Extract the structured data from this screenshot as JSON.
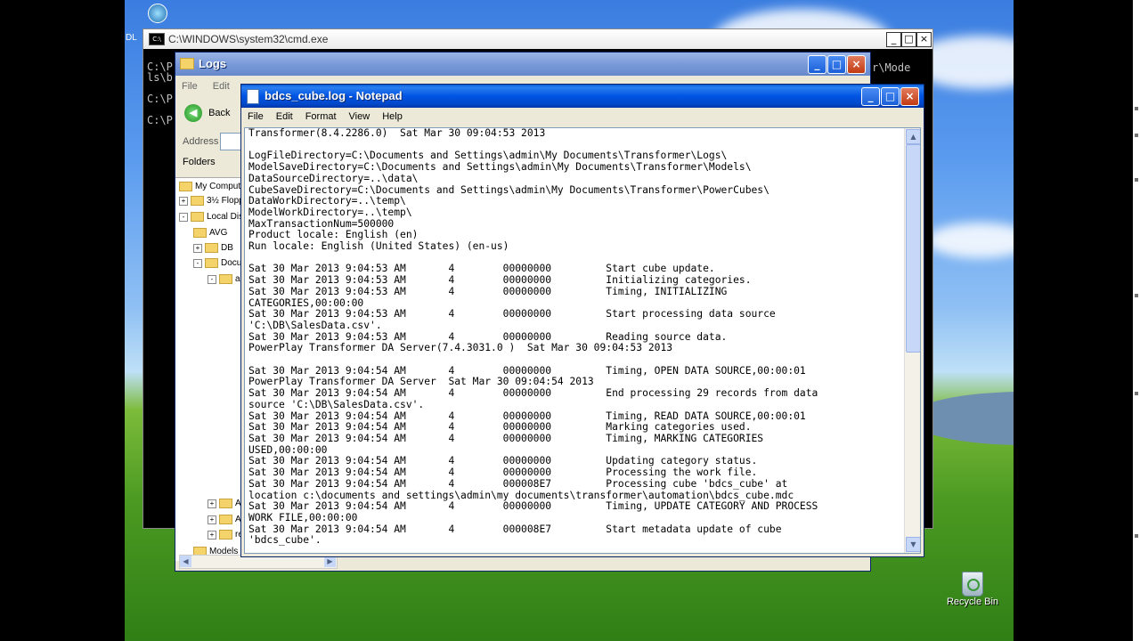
{
  "desktop": {
    "recycle_bin_label": "Recycle Bin",
    "left_edge_label": "DL"
  },
  "cmd_window": {
    "title": "C:\\WINDOWS\\system32\\cmd.exe",
    "visible_lines": [
      "C:\\P",
      "ls\\b",
      "",
      "C:\\P",
      "",
      "C:\\P"
    ],
    "right_fragment": "r\\Mode"
  },
  "explorer_window": {
    "title": "Logs",
    "menu": [
      "File",
      "Edit"
    ],
    "back_label": "Back",
    "address_label": "Address",
    "folders_label": "Folders",
    "tree": [
      {
        "label": "My Computer",
        "indent": 0,
        "expand": ""
      },
      {
        "label": "3½ Floppy",
        "indent": 0,
        "expand": "+"
      },
      {
        "label": "Local Disk",
        "indent": 0,
        "expand": "-"
      },
      {
        "label": "AVG",
        "indent": 1,
        "expand": ""
      },
      {
        "label": "DB",
        "indent": 1,
        "expand": "+"
      },
      {
        "label": "Docum",
        "indent": 1,
        "expand": "-"
      },
      {
        "label": "ad",
        "indent": 2,
        "expand": "-"
      },
      {
        "label": "Ac",
        "indent": 2,
        "expand": "+"
      },
      {
        "label": "All",
        "indent": 2,
        "expand": "+"
      },
      {
        "label": "re",
        "indent": 2,
        "expand": "+"
      },
      {
        "label": "Models",
        "indent": 1,
        "expand": ""
      }
    ]
  },
  "notepad": {
    "title": "bdcs_cube.log - Notepad",
    "menu": [
      "File",
      "Edit",
      "Format",
      "View",
      "Help"
    ],
    "lines": [
      "Transformer(8.4.2286.0)  Sat Mar 30 09:04:53 2013",
      "",
      "LogFileDirectory=C:\\Documents and Settings\\admin\\My Documents\\Transformer\\Logs\\",
      "ModelSaveDirectory=C:\\Documents and Settings\\admin\\My Documents\\Transformer\\Models\\",
      "DataSourceDirectory=..\\data\\",
      "CubeSaveDirectory=C:\\Documents and Settings\\admin\\My Documents\\Transformer\\PowerCubes\\",
      "DataWorkDirectory=..\\temp\\",
      "ModelWorkDirectory=..\\temp\\",
      "MaxTransactionNum=500000",
      "Product locale: English (en)",
      "Run locale: English (United States) (en-us)",
      "",
      "Sat 30 Mar 2013 9:04:53 AM       4        00000000         Start cube update.",
      "Sat 30 Mar 2013 9:04:53 AM       4        00000000         Initializing categories.",
      "Sat 30 Mar 2013 9:04:53 AM       4        00000000         Timing, INITIALIZING",
      "CATEGORIES,00:00:00",
      "Sat 30 Mar 2013 9:04:53 AM       4        00000000         Start processing data source",
      "'C:\\DB\\SalesData.csv'.",
      "Sat 30 Mar 2013 9:04:53 AM       4        00000000         Reading source data.",
      "PowerPlay Transformer DA Server(7.4.3031.0 )  Sat Mar 30 09:04:53 2013",
      "",
      "Sat 30 Mar 2013 9:04:54 AM       4        00000000         Timing, OPEN DATA SOURCE,00:00:01",
      "PowerPlay Transformer DA Server  Sat Mar 30 09:04:54 2013",
      "Sat 30 Mar 2013 9:04:54 AM       4        00000000         End processing 29 records from data",
      "source 'C:\\DB\\SalesData.csv'.",
      "Sat 30 Mar 2013 9:04:54 AM       4        00000000         Timing, READ DATA SOURCE,00:00:01",
      "Sat 30 Mar 2013 9:04:54 AM       4        00000000         Marking categories used.",
      "Sat 30 Mar 2013 9:04:54 AM       4        00000000         Timing, MARKING CATEGORIES",
      "USED,00:00:00",
      "Sat 30 Mar 2013 9:04:54 AM       4        00000000         Updating category status.",
      "Sat 30 Mar 2013 9:04:54 AM       4        00000000         Processing the work file.",
      "Sat 30 Mar 2013 9:04:54 AM       4        000008E7         Processing cube 'bdcs_cube' at",
      "location c:\\documents and settings\\admin\\my documents\\transformer\\automation\\bdcs_cube.mdc",
      "Sat 30 Mar 2013 9:04:54 AM       4        00000000         Timing, UPDATE CATEGORY AND PROCESS",
      "WORK FILE,00:00:00",
      "Sat 30 Mar 2013 9:04:54 AM       4        000008E7         Start metadata update of cube",
      "'bdcs_cube'."
    ]
  }
}
